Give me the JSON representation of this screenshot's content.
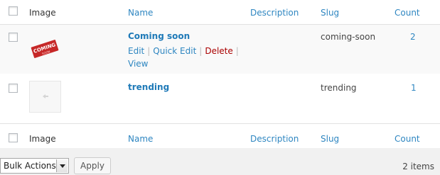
{
  "columns": {
    "image": "Image",
    "name": "Name",
    "description": "Description",
    "slug": "Slug",
    "count": "Count"
  },
  "rows": [
    {
      "name": "Coming soon",
      "slug": "coming-soon",
      "count": "2",
      "thumbnail_text": "COMING",
      "thumbnail_subtext": "SOON",
      "actions": [
        "Edit",
        "Quick Edit",
        "Delete",
        "View"
      ]
    },
    {
      "name": "trending",
      "slug": "trending",
      "count": "1"
    }
  ],
  "bulk": {
    "selected": "Bulk Actions",
    "apply": "Apply",
    "items_count": "2 items"
  },
  "colors": {
    "link": "#2e86c1",
    "delete": "#a00000",
    "badge_red": "#c62828"
  }
}
